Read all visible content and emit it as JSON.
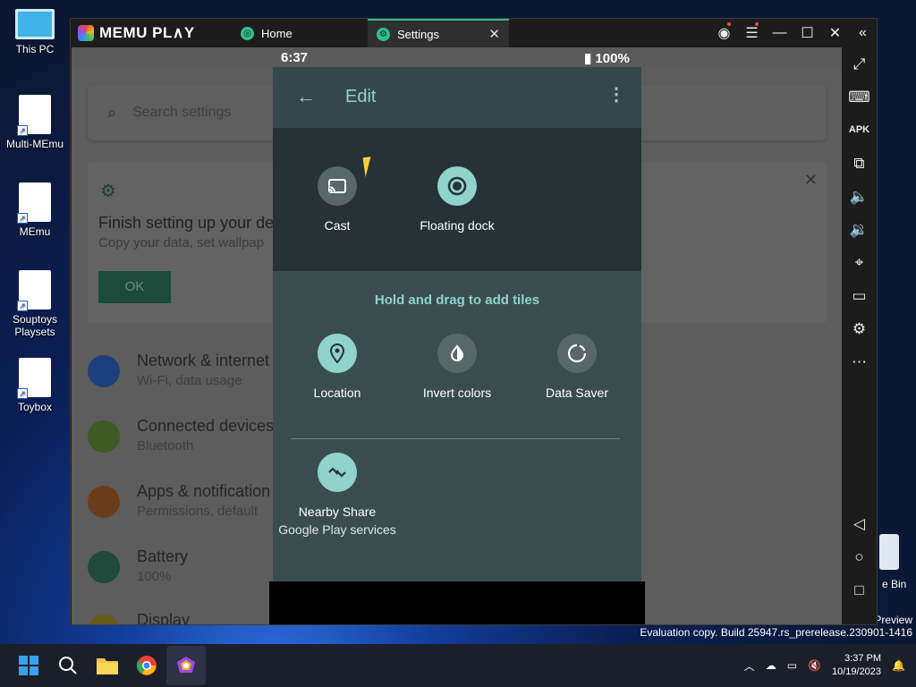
{
  "desktop": {
    "icons": [
      {
        "label": "This PC"
      },
      {
        "label": "Multi-MEmu"
      },
      {
        "label": "MEmu"
      },
      {
        "label": "Souptoys Playsets"
      },
      {
        "label": "Toybox"
      }
    ],
    "recycle_label": "e Bin",
    "preview_label": "Preview",
    "evaluation_text": "Evaluation copy. Build 25947.rs_prerelease.230901-1416"
  },
  "window": {
    "brand": "MEMU PL∧Y",
    "tabs": [
      {
        "label": "Home"
      },
      {
        "label": "Settings"
      }
    ]
  },
  "android": {
    "status_time": "6:37",
    "battery": "100%",
    "settings": {
      "search_placeholder": "Search settings",
      "card_title": "Finish setting up your de",
      "card_sub": "Copy your data, set wallpap",
      "ok_label": "OK",
      "items": [
        {
          "title": "Network & internet",
          "sub": "Wi-Fi, data usage"
        },
        {
          "title": "Connected devices",
          "sub": "Bluetooth"
        },
        {
          "title": "Apps & notification",
          "sub": "Permissions, default"
        },
        {
          "title": "Battery",
          "sub": "100%"
        },
        {
          "title": "Display",
          "sub": ""
        }
      ]
    },
    "edit": {
      "title": "Edit",
      "active_tiles": [
        {
          "label": "Cast"
        },
        {
          "label": "Floating dock"
        }
      ],
      "hint": "Hold and drag to add tiles",
      "available_tiles": [
        {
          "label": "Location"
        },
        {
          "label": "Invert colors"
        },
        {
          "label": "Data Saver"
        }
      ],
      "extra_tile": {
        "label": "Nearby Share",
        "sub": "Google Play services"
      }
    }
  },
  "taskbar": {
    "time": "3:37 PM",
    "date": "10/19/2023"
  },
  "colors": {
    "accent": "#8fd3cb",
    "memu_green": "#2fc28c"
  }
}
